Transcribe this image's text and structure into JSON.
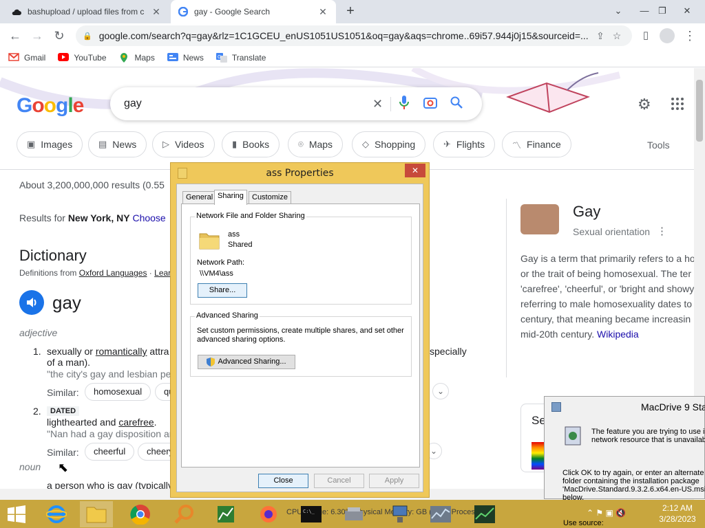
{
  "browser": {
    "tabs": [
      {
        "title": "bashupload / upload files from c",
        "icon": "cloud-icon"
      },
      {
        "title": "gay - Google Search",
        "icon": "google-icon"
      }
    ],
    "url": "google.com/search?q=gay&rlz=1C1GCEU_enUS1051US1051&oq=gay&aqs=chrome..69i57.944j0j15&sourceid=...",
    "bookmarks": [
      "Gmail",
      "YouTube",
      "Maps",
      "News",
      "Translate"
    ]
  },
  "google": {
    "logo": "Google",
    "query": "gay",
    "chips": [
      "Images",
      "News",
      "Videos",
      "Books",
      "Maps",
      "Shopping",
      "Flights",
      "Finance"
    ],
    "tools": "Tools",
    "results_count": "About 3,200,000,000 results (0.55",
    "results_for_prefix": "Results for",
    "location": "New York, NY",
    "choose": "Choose",
    "dictionary": {
      "heading": "Dictionary",
      "source_prefix": "Definitions from",
      "source": "Oxford Languages",
      "learn": "Lear",
      "word": "gay",
      "pos1": "adjective",
      "def1_num": "1.",
      "def1_pre": "sexually or",
      "def1_link": "romantically",
      "def1_post": "attra",
      "def1_end": "specially",
      "def1_line2": "of a man).",
      "def1_example": "\"the city's gay and lesbian pe",
      "similar_label": "Similar:",
      "similar1": [
        "homosexual",
        "qu"
      ],
      "def2_num": "2.",
      "def2_tag": "DATED",
      "def2_pre": "lighthearted and",
      "def2_link": "carefree",
      "def2_post": ".",
      "def2_example": "\"Nan had a gay disposition ar",
      "similar2": [
        "cheerful",
        "cheery"
      ],
      "pos2": "noun",
      "def3_start": "a person who is gay (typically"
    },
    "knowledge": {
      "title": "Gay",
      "subtitle": "Sexual orientation",
      "lines": [
        "Gay is a term that primarily refers to a ho",
        "or the trait of being homosexual. The ter",
        "'carefree', 'cheerful', or 'bright and showy'",
        "referring to male homosexuality dates to",
        "century, that meaning became increasin",
        "mid-20th century."
      ],
      "wiki": "Wikipedia",
      "se": "Se"
    }
  },
  "dialog": {
    "title": "ass Properties",
    "tabs": [
      "General",
      "Sharing",
      "Customize"
    ],
    "group1_label": "Network File and Folder Sharing",
    "folder_name": "ass",
    "folder_status": "Shared",
    "network_path_label": "Network Path:",
    "network_path": "\\\\VM4\\ass",
    "share_button": "Share...",
    "group2_label": "Advanced Sharing",
    "adv_text1": "Set custom permissions, create multiple shares, and set other",
    "adv_text2": "advanced sharing options.",
    "adv_button": "Advanced Sharing...",
    "close": "Close",
    "cancel": "Cancel",
    "apply": "Apply"
  },
  "macdrive": {
    "title": "MacDrive 9 Sta",
    "text1": "The feature you are trying to use is",
    "text2": "network resource that is unavailab",
    "text3": "Click OK to try again, or enter an alternate pa",
    "text4": "folder containing the installation package",
    "text5": "'MacDrive.Standard.9.3.2.6.x64.en-US.msi' i",
    "text6": "below.",
    "text7": "Use source:"
  },
  "taskbar": {
    "overlay_text": "CPU Usage: 6.30%   Physical Memory: GB (41%)   Processes: 5",
    "time": "2:12 AM",
    "date": "3/28/2023"
  },
  "colors": {
    "taskbar": "#c8a63e",
    "dialog_frame": "#efc85a",
    "google_blue": "#1a73e8",
    "link": "#1a0dab"
  }
}
